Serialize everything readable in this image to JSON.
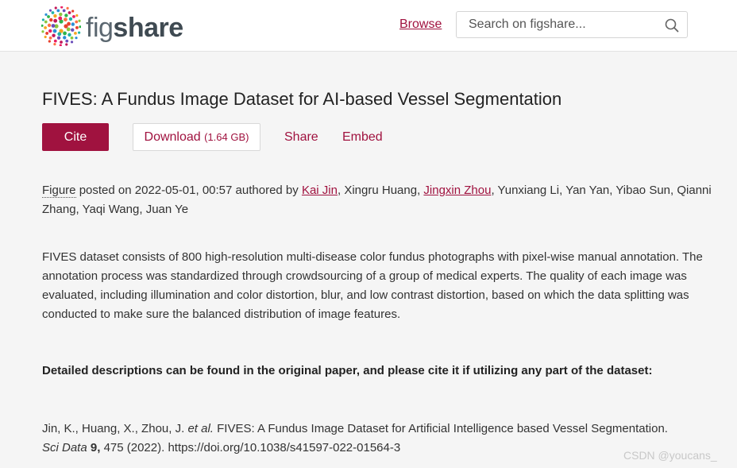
{
  "header": {
    "logo": {
      "text_light": "fig",
      "text_bold": "share"
    },
    "browse_label": "Browse",
    "search": {
      "placeholder": "Search on figshare..."
    }
  },
  "item": {
    "title": "FIVES: A Fundus Image Dataset for AI-based Vessel Segmentation",
    "actions": {
      "cite_label": "Cite",
      "download_label": "Download",
      "download_size": "(1.64 GB)",
      "share_label": "Share",
      "embed_label": "Embed"
    },
    "meta": {
      "type": "Figure",
      "posted_prefix": "posted on",
      "posted_date": "2022-05-01, 00:57",
      "authored_by": "authored by",
      "authors": [
        {
          "name": "Kai Jin",
          "linked": true
        },
        {
          "name": "Xingru Huang",
          "linked": false
        },
        {
          "name": "Jingxin Zhou",
          "linked": true
        },
        {
          "name": "Yunxiang Li",
          "linked": false
        },
        {
          "name": "Yan Yan",
          "linked": false
        },
        {
          "name": "Yibao Sun",
          "linked": false
        },
        {
          "name": "Qianni Zhang",
          "linked": false
        },
        {
          "name": "Yaqi Wang",
          "linked": false
        },
        {
          "name": "Juan Ye",
          "linked": false
        }
      ]
    },
    "description": "FIVES dataset consists of 800 high-resolution multi-disease color fundus photographs with pixel-wise manual annotation. The annotation process was standardized through crowdsourcing of a group of medical experts. The quality of each image was evaluated, including illumination and color distortion, blur, and low contrast distortion, based on which the data splitting was conducted to make sure the balanced distribution of image features.",
    "note": "Detailed descriptions can be found in the original paper, and please cite it if utilizing any part of the dataset:",
    "citation": {
      "authors": "Jin, K., Huang, X., Zhou, J.",
      "etal": "et al.",
      "title": "FIVES: A Fundus Image Dataset for Artificial Intelligence based Vessel Segmentation.",
      "journal": "Sci Data",
      "volume": "9,",
      "pages_year": "475 (2022).",
      "doi": "https://doi.org/10.1038/s41597-022-01564-3"
    }
  },
  "watermark": "CSDN @youcans_",
  "colors": {
    "accent": "#a0123f",
    "background": "#f5f5f5",
    "header_bg": "#ffffff"
  },
  "icons": {
    "logo": "figshare-dots-logo",
    "search": "search-icon"
  }
}
